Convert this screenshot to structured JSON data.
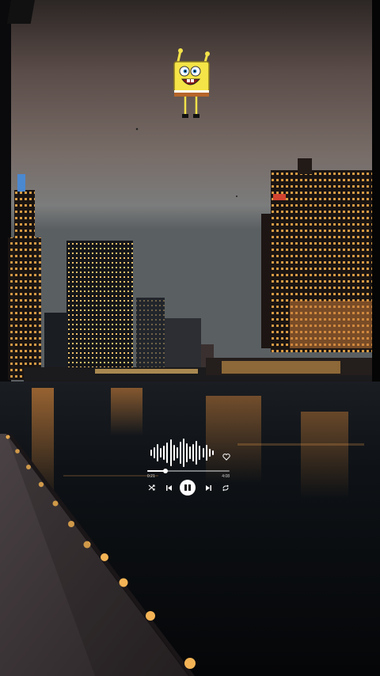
{
  "player": {
    "elapsed": "0:21",
    "duration": "4:08",
    "progress_fraction": 0.22,
    "state": "playing",
    "icons": {
      "shuffle": "shuffle-icon",
      "previous": "skip-previous-icon",
      "pause": "pause-icon",
      "next": "skip-next-icon",
      "repeat": "repeat-icon",
      "like": "heart-icon"
    }
  },
  "sticker": {
    "character": "spongebob-sticker"
  },
  "colors": {
    "sky_top": "#3a3230",
    "sky_mid": "#6a5d58",
    "sky_low": "#7d7e7e",
    "water": "#0e1114",
    "city_light": "#f0b04a",
    "ui": "#ffffff"
  }
}
